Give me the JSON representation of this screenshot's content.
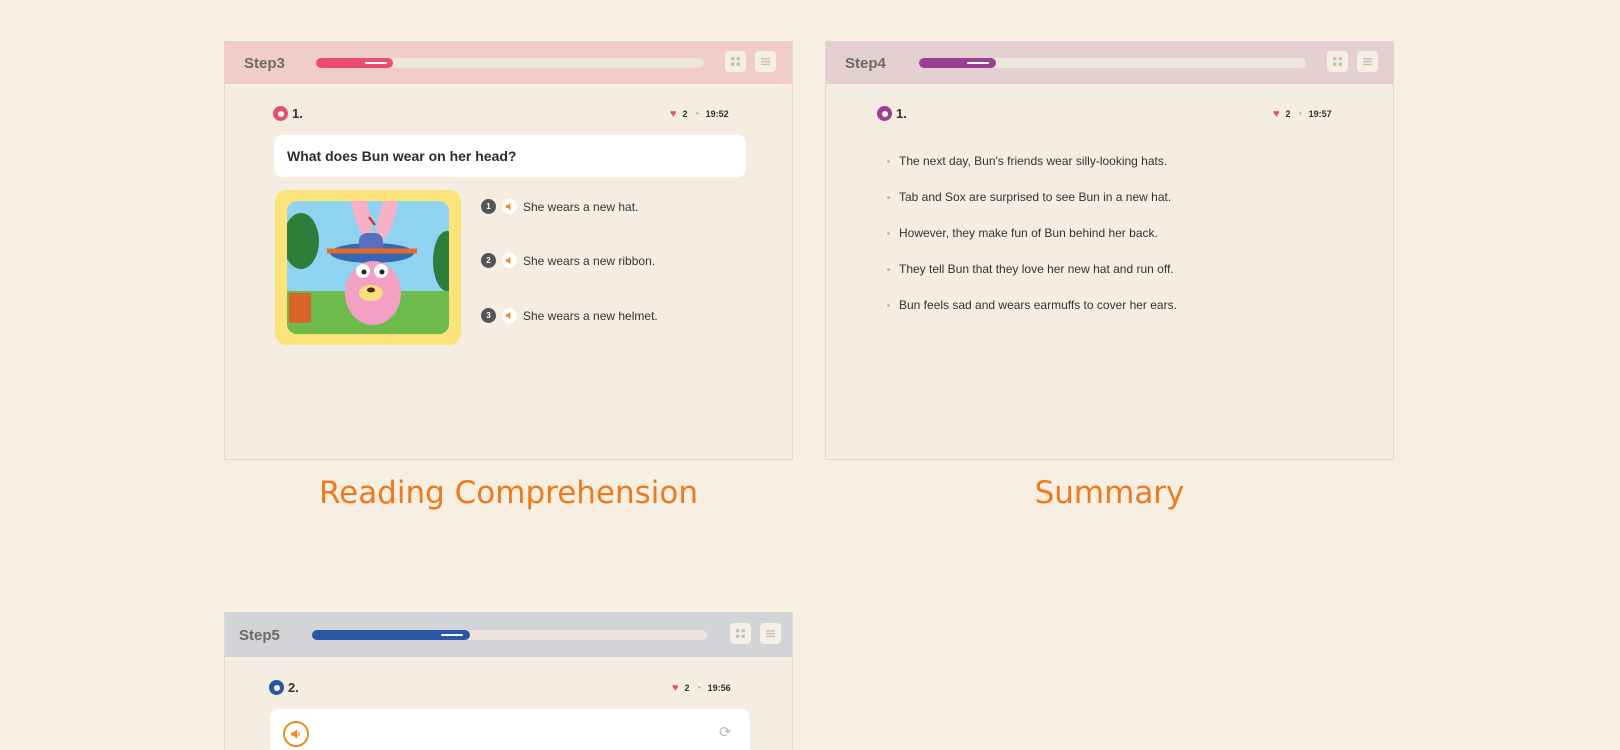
{
  "cards": {
    "step3": {
      "step_label": "Step3",
      "progress": 0.2,
      "accent": "#e94f6c",
      "header_bg": "#f1cdc9",
      "question_number": "1.",
      "hearts": "2",
      "time": "19:52",
      "question": "What does Bun wear on her head?",
      "options": [
        {
          "num": "1",
          "text": "She wears a new hat."
        },
        {
          "num": "2",
          "text": "She wears a new ribbon."
        },
        {
          "num": "3",
          "text": "She wears a new helmet."
        }
      ],
      "caption": "Reading Comprehension"
    },
    "step4": {
      "step_label": "Step4",
      "progress": 0.2,
      "accent": "#9b3f93",
      "header_bg": "#e4cfd1",
      "question_number": "1.",
      "hearts": "2",
      "time": "19:57",
      "summary": [
        "The next day, Bun's friends wear silly-looking hats.",
        "Tab and Sox are surprised to see Bun in a new hat.",
        "However, they make fun of Bun behind her back.",
        "They tell Bun that they love her new hat and run off.",
        "Bun feels sad and wears earmuffs to cover her ears."
      ],
      "caption": "Summary"
    },
    "step5": {
      "step_label": "Step5",
      "progress": 0.4,
      "accent": "#2b56a6",
      "header_bg": "#d2d4d8",
      "question_number": "2.",
      "hearts": "2",
      "time": "19:56"
    }
  },
  "icons": {
    "grid": "grid-icon",
    "list": "list-icon",
    "heart": "heart-icon",
    "clock": "clock-icon",
    "speaker": "speaker-icon",
    "refresh": "refresh-icon"
  }
}
